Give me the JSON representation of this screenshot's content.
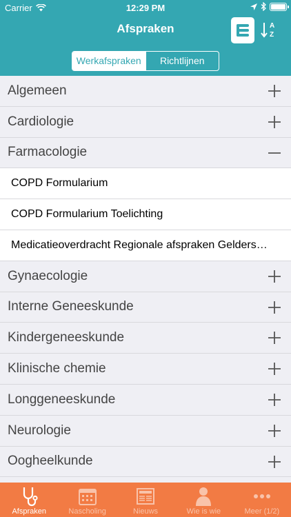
{
  "statusbar": {
    "carrier": "Carrier",
    "time": "12:29 PM"
  },
  "nav": {
    "title": "Afspraken",
    "sort_letters": {
      "top": "A",
      "bottom": "Z"
    }
  },
  "segments": {
    "active": "Werkafspraken",
    "inactive": "Richtlijnen"
  },
  "list": [
    {
      "type": "category",
      "label": "Algemeen",
      "expanded": false
    },
    {
      "type": "category",
      "label": "Cardiologie",
      "expanded": false
    },
    {
      "type": "category",
      "label": "Farmacologie",
      "expanded": true
    },
    {
      "type": "item",
      "label": "COPD Formularium"
    },
    {
      "type": "item",
      "label": "COPD Formularium Toelichting"
    },
    {
      "type": "item",
      "label": "Medicatieoverdracht Regionale afspraken Gelderse Vallei"
    },
    {
      "type": "category",
      "label": "Gynaecologie",
      "expanded": false
    },
    {
      "type": "category",
      "label": "Interne Geneeskunde",
      "expanded": false
    },
    {
      "type": "category",
      "label": "Kindergeneeskunde",
      "expanded": false
    },
    {
      "type": "category",
      "label": "Klinische chemie",
      "expanded": false
    },
    {
      "type": "category",
      "label": "Longgeneeskunde",
      "expanded": false
    },
    {
      "type": "category",
      "label": "Neurologie",
      "expanded": false
    },
    {
      "type": "category",
      "label": "Oogheelkunde",
      "expanded": false
    }
  ],
  "tabs": [
    {
      "label": "Afspraken",
      "icon": "stethoscope-icon",
      "active": true
    },
    {
      "label": "Nascholing",
      "icon": "calendar-icon",
      "active": false
    },
    {
      "label": "Nieuws",
      "icon": "newspaper-icon",
      "active": false
    },
    {
      "label": "Wie is wie",
      "icon": "person-icon",
      "active": false
    },
    {
      "label": "Meer (1/2)",
      "icon": "more-icon",
      "active": false
    }
  ],
  "colors": {
    "header": "#34a7b2",
    "tabbar": "#f27b44",
    "category_bg": "#efeff4"
  }
}
